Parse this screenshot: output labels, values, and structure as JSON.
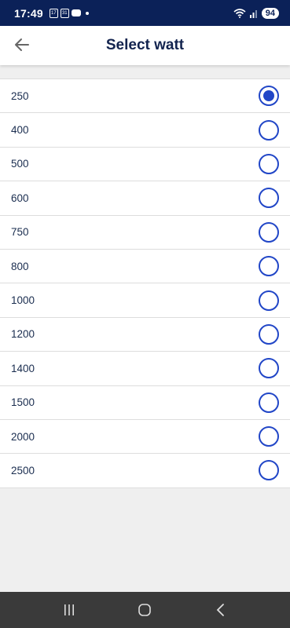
{
  "status_bar": {
    "time": "17:49",
    "notif_icons": [
      "calendar-17-icon",
      "calendar-31-icon",
      "message-icon"
    ],
    "battery": "94"
  },
  "header": {
    "title": "Select watt",
    "back_icon": "arrow-left-icon"
  },
  "options": [
    {
      "label": "250",
      "selected": true
    },
    {
      "label": "400",
      "selected": false
    },
    {
      "label": "500",
      "selected": false
    },
    {
      "label": "600",
      "selected": false
    },
    {
      "label": "750",
      "selected": false
    },
    {
      "label": "800",
      "selected": false
    },
    {
      "label": "1000",
      "selected": false
    },
    {
      "label": "1200",
      "selected": false
    },
    {
      "label": "1400",
      "selected": false
    },
    {
      "label": "1500",
      "selected": false
    },
    {
      "label": "2000",
      "selected": false
    },
    {
      "label": "2500",
      "selected": false
    }
  ],
  "colors": {
    "status_bar": "#0b2158",
    "accent": "#2146c7",
    "title": "#13244f",
    "nav_bar": "#3a3a3a"
  },
  "nav": [
    "recent-apps-icon",
    "home-icon",
    "back-icon"
  ]
}
